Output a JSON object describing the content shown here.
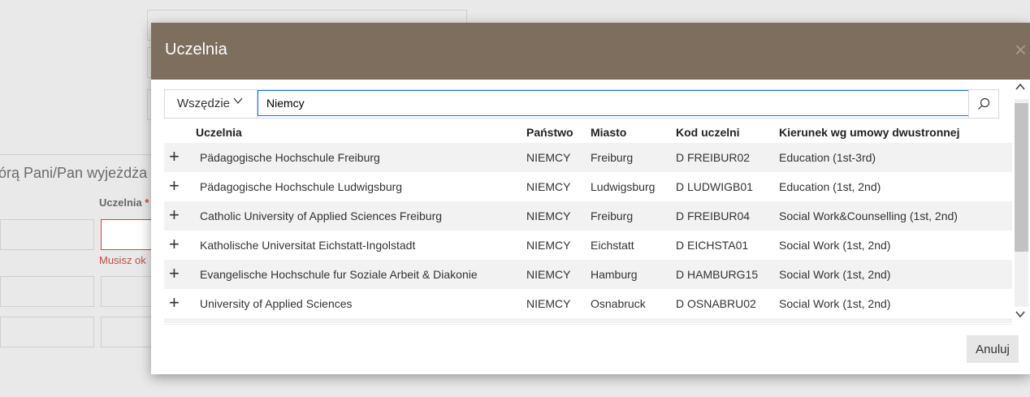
{
  "background": {
    "section_heading": "órą Pani/Pan wyjeżdża",
    "column_label": "Uczelnia",
    "required_mark": "*",
    "error_text": "Musisz ok"
  },
  "modal": {
    "title": "Uczelnia",
    "close_icon": "×",
    "search": {
      "scope_label": "Wszędzie",
      "query": "Niemcy",
      "search_icon": "search-icon"
    },
    "columns": [
      "Uczelnia",
      "Państwo",
      "Miasto",
      "Kod uczelni",
      "Kierunek wg umowy dwustronnej"
    ],
    "rows": [
      {
        "name": "Pädagogische Hochschule Freiburg",
        "country": "NIEMCY",
        "city": "Freiburg",
        "code": "D FREIBUR02",
        "field": "Education (1st-3rd)"
      },
      {
        "name": "Pädagogische Hochschule Ludwigsburg",
        "country": "NIEMCY",
        "city": "Ludwigsburg",
        "code": "D LUDWIGB01",
        "field": "Education (1st, 2nd)"
      },
      {
        "name": "Catholic University of Applied Sciences Freiburg",
        "country": "NIEMCY",
        "city": "Freiburg",
        "code": "D FREIBUR04",
        "field": "Social Work&Counselling (1st, 2nd)"
      },
      {
        "name": "Katholische Universitat Eichstatt-Ingolstadt",
        "country": "NIEMCY",
        "city": "Eichstatt",
        "code": "D EICHSTA01",
        "field": "Social Work (1st, 2nd)"
      },
      {
        "name": "Evangelische Hochschule fur Soziale Arbeit & Diakonie",
        "country": "NIEMCY",
        "city": "Hamburg",
        "code": "D HAMBURG15",
        "field": "Social Work (1st, 2nd)"
      },
      {
        "name": "University of Applied Sciences",
        "country": "NIEMCY",
        "city": "Osnabruck",
        "code": "D OSNABRU02",
        "field": "Social Work (1st, 2nd)"
      }
    ],
    "add_symbol": "+",
    "cancel_label": "Anuluj"
  }
}
